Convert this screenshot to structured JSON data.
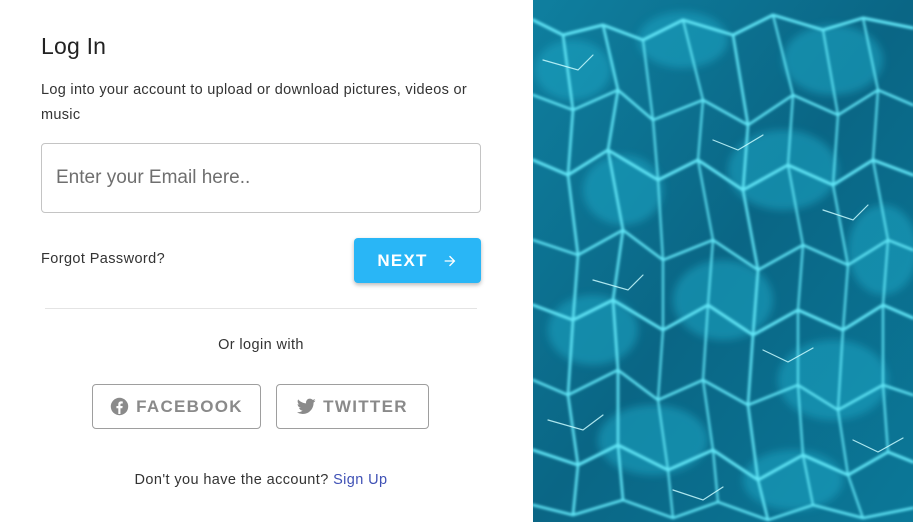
{
  "login": {
    "title": "Log In",
    "subtitle": "Log into your account to upload or download pictures, videos or music",
    "email_placeholder": "Enter your Email here..",
    "forgot_password": "Forgot Password?",
    "next_label": "NEXT",
    "or_login_with": "Or login with",
    "facebook_label": "FACEBOOK",
    "twitter_label": "TWITTER",
    "no_account_text": "Don't you have the account?",
    "signup_label": "Sign Up"
  },
  "icons": {
    "next": "arrow-right-icon",
    "facebook": "facebook-icon",
    "twitter": "twitter-icon"
  },
  "colors": {
    "accent": "#29b6f6",
    "link": "#3f51b5",
    "social_text": "#8a8a8a",
    "water_dark": "#0a5f7e",
    "water_light": "#5ee3f5"
  }
}
